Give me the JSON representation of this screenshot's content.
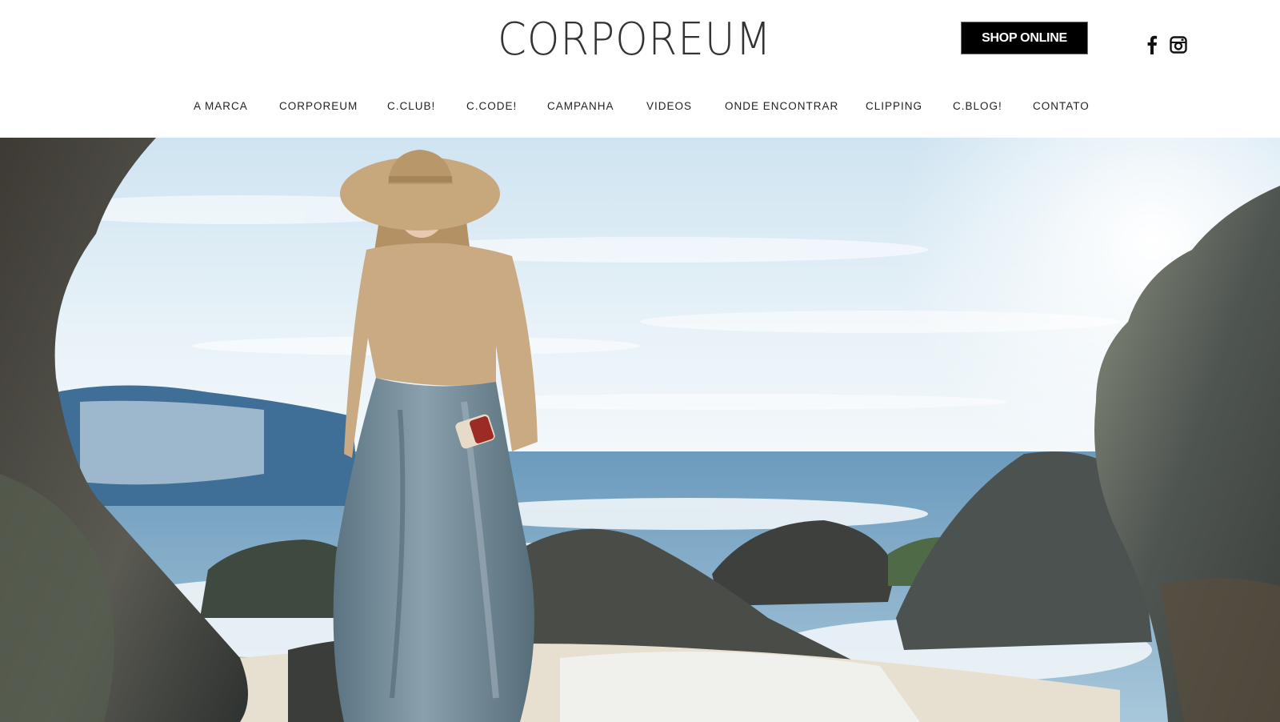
{
  "brand": {
    "logo_text": "CORPOREUM"
  },
  "header": {
    "shop_label": "SHOP ONLINE",
    "social": [
      {
        "name": "facebook",
        "icon": "facebook-icon"
      },
      {
        "name": "instagram",
        "icon": "instagram-icon"
      }
    ]
  },
  "nav": {
    "items": [
      {
        "label": "A MARCA"
      },
      {
        "label": "CORPOREUM"
      },
      {
        "label": "C.CLUB!"
      },
      {
        "label": "C.CODE!"
      },
      {
        "label": "CAMPANHA"
      },
      {
        "label": "VIDEOS"
      },
      {
        "label": "ONDE ENCONTRAR"
      },
      {
        "label": "CLIPPING"
      },
      {
        "label": "C.BLOG!"
      },
      {
        "label": "CONTATO"
      }
    ]
  },
  "hero": {
    "image": "campaign-photo",
    "colors": {
      "sky": "#dfeef7",
      "sea": "#7fa9c7",
      "rock": "#4f5450",
      "skirt": "#6f8796",
      "sweater": "#c9ab83",
      "sand": "#e9e2d3"
    }
  },
  "colors": {
    "button_bg": "#000000",
    "button_border": "#3d7ab8",
    "text": "#222222"
  }
}
